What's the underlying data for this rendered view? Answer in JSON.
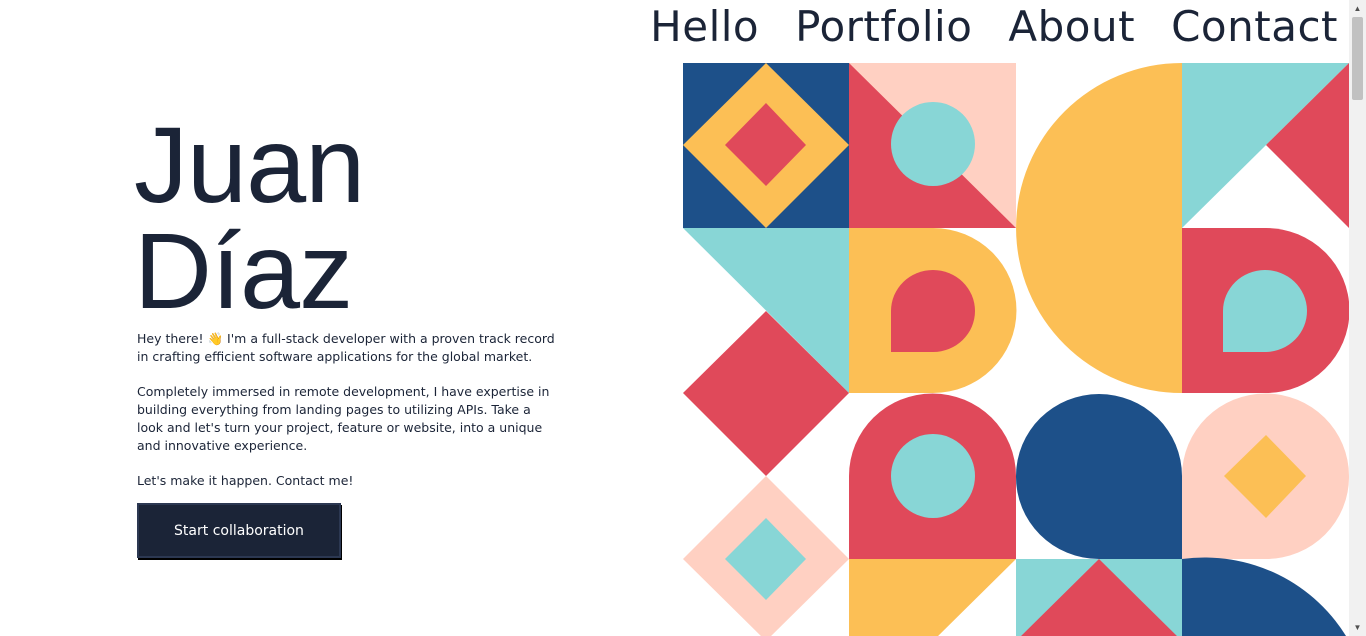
{
  "nav": {
    "items": [
      "Hello",
      "Portfolio",
      "About",
      "Contact"
    ]
  },
  "hero": {
    "first_name": "Juan",
    "last_name": "Díaz",
    "paragraph1": "Hey there! 👋 I'm a full-stack developer with a proven track record in crafting efficient software applications for the global market.",
    "paragraph2": "Completely immersed in remote development, I have expertise in building everything from landing pages to utilizing APIs. Take a look and let's turn your project, feature or website, into a unique and innovative experience.",
    "paragraph3": "Let's make it happen. Contact me!",
    "cta_label": "Start collaboration"
  },
  "colors": {
    "navy": "#1d5089",
    "yellow": "#fcbf55",
    "red": "#e0495a",
    "teal": "#88d6d6",
    "peach": "#ffd0c2",
    "text": "#1b2437"
  },
  "scrollbar": {
    "up_icon": "triangle-up",
    "down_icon": "triangle-down"
  }
}
